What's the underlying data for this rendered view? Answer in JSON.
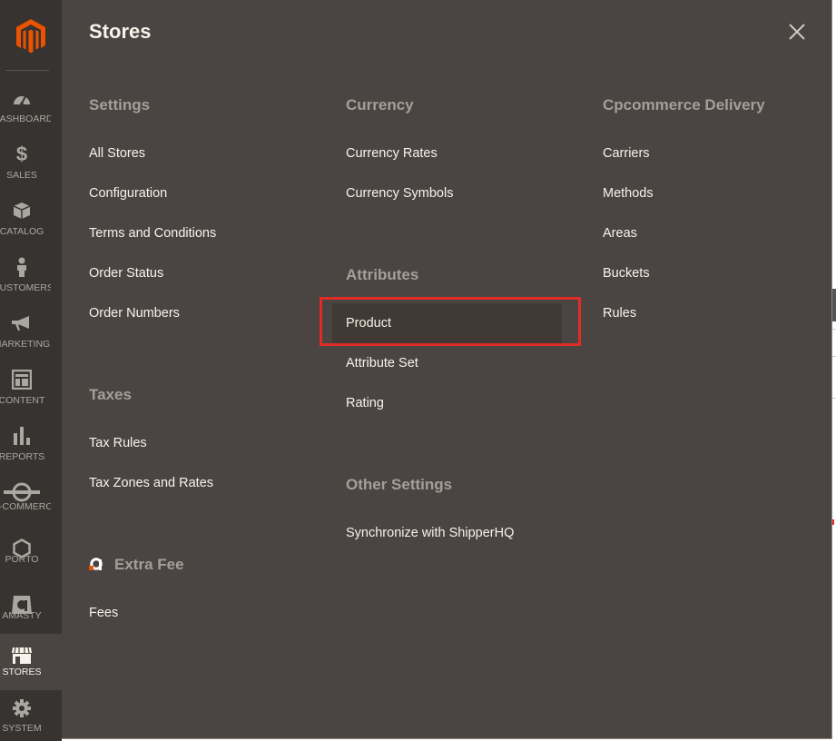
{
  "sidebar": {
    "items": [
      {
        "label": "DASHBOARD",
        "icon": "dashboard-icon"
      },
      {
        "label": "SALES",
        "icon": "dollar-icon"
      },
      {
        "label": "CATALOG",
        "icon": "box-icon"
      },
      {
        "label": "CUSTOMERS",
        "icon": "person-icon"
      },
      {
        "label": "MARKETING",
        "icon": "megaphone-icon"
      },
      {
        "label": "CONTENT",
        "icon": "layout-icon"
      },
      {
        "label": "REPORTS",
        "icon": "bar-chart-icon"
      },
      {
        "label": "E-COMMERCE",
        "icon": "ecommerce-icon"
      },
      {
        "label": "PORTO",
        "icon": "hexagon-icon"
      },
      {
        "label": "AMASTY",
        "icon": "amasty-icon"
      },
      {
        "label": "STORES",
        "icon": "storefront-icon",
        "active": true
      },
      {
        "label": "SYSTEM",
        "icon": "gear-icon"
      }
    ]
  },
  "panel": {
    "title": "Stores",
    "close_icon": "close-icon",
    "columns": [
      {
        "groups": [
          {
            "title": "Settings",
            "links": [
              "All Stores",
              "Configuration",
              "Terms and Conditions",
              "Order Status",
              "Order Numbers"
            ]
          },
          {
            "title": "Taxes",
            "links": [
              "Tax Rules",
              "Tax Zones and Rates"
            ]
          },
          {
            "title": "Extra Fee",
            "icon": "amasty-logo-icon",
            "links": [
              "Fees"
            ]
          }
        ]
      },
      {
        "groups": [
          {
            "title": "Currency",
            "links": [
              "Currency Rates",
              "Currency Symbols"
            ]
          },
          {
            "title": "Attributes",
            "links": [
              "Product",
              "Attribute Set",
              "Rating"
            ],
            "highlighted": "Product"
          },
          {
            "title": "Other Settings",
            "links": [
              "Synchronize with ShipperHQ"
            ]
          }
        ]
      },
      {
        "groups": [
          {
            "title": "Cpcommerce Delivery",
            "links": [
              "Carriers",
              "Methods",
              "Areas",
              "Buckets",
              "Rules"
            ]
          }
        ]
      }
    ]
  },
  "colors": {
    "panel_bg": "#4a4542",
    "sidebar_bg": "#373330",
    "group_title": "#a59f97",
    "link_text": "#f7f3eb",
    "highlight_border": "#e02b27",
    "brand_orange": "#eb5202"
  }
}
